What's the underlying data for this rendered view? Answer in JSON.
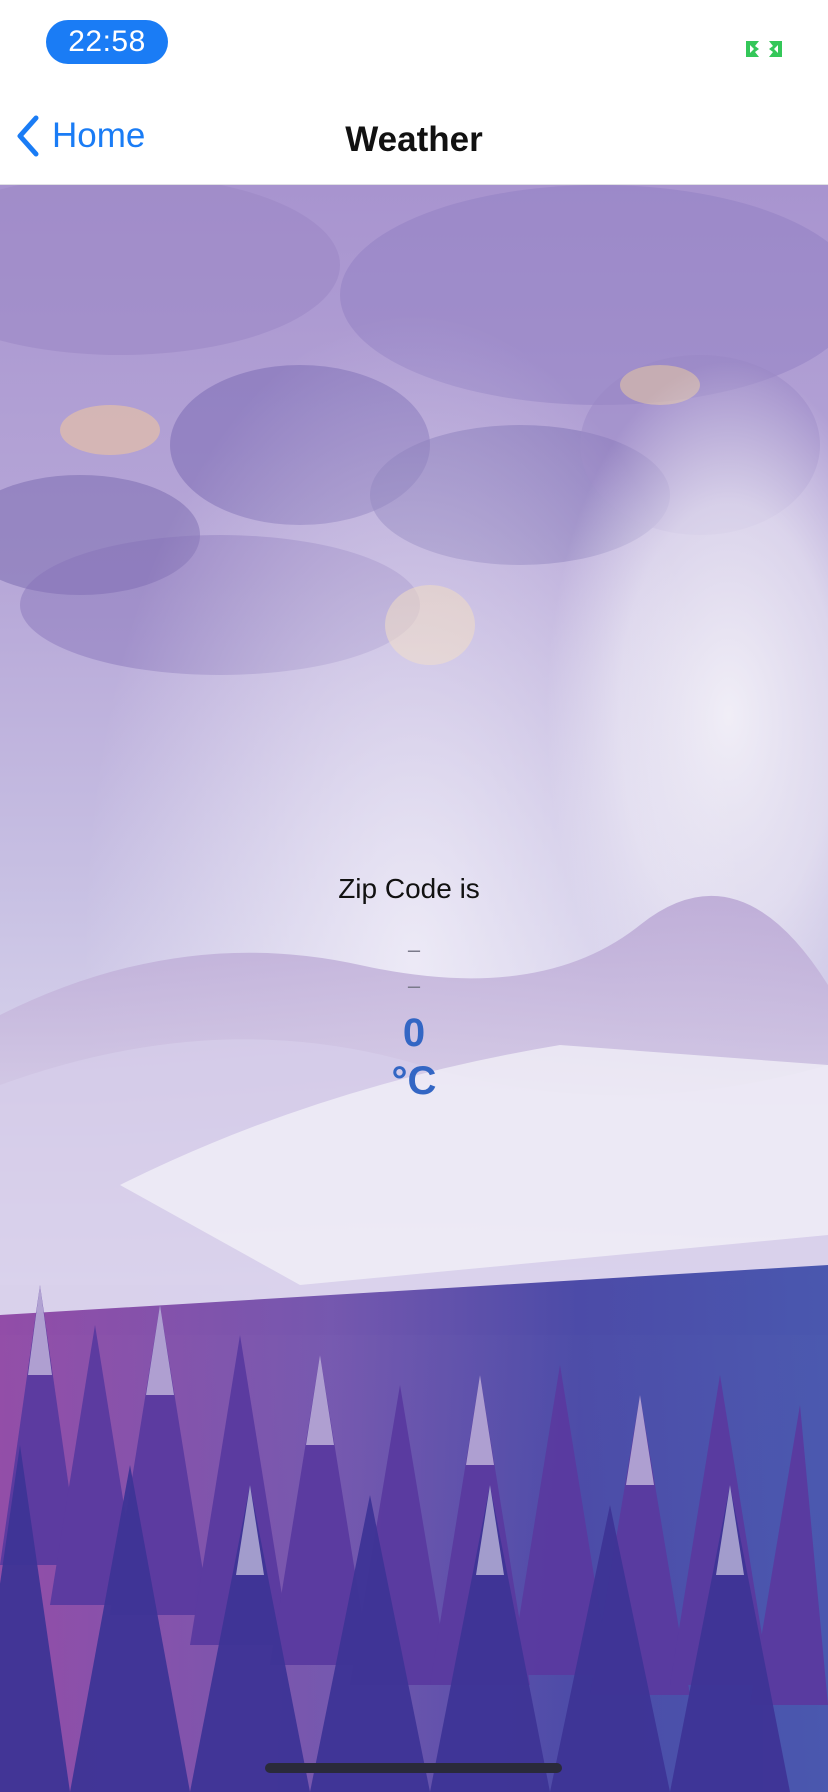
{
  "status_bar": {
    "time": "22:58",
    "time_pill_color": "#1a7cf5",
    "screen_mirroring_icon": "screen-mirroring-icon",
    "screen_mirroring_color": "#34c759"
  },
  "nav_bar": {
    "back_label": "Home",
    "back_icon": "chevron-left-icon",
    "title": "Weather",
    "accent_color": "#1a7cf5"
  },
  "weather": {
    "zip_label": "Zip Code is",
    "city": "–",
    "description": "–",
    "temperature": "0",
    "unit": "°C",
    "temperature_color": "#3366c4"
  },
  "background": {
    "description_icon": "snowy-forest-background",
    "sky_color": "#9c8cc4",
    "tree_color": "#4a3c9c"
  }
}
